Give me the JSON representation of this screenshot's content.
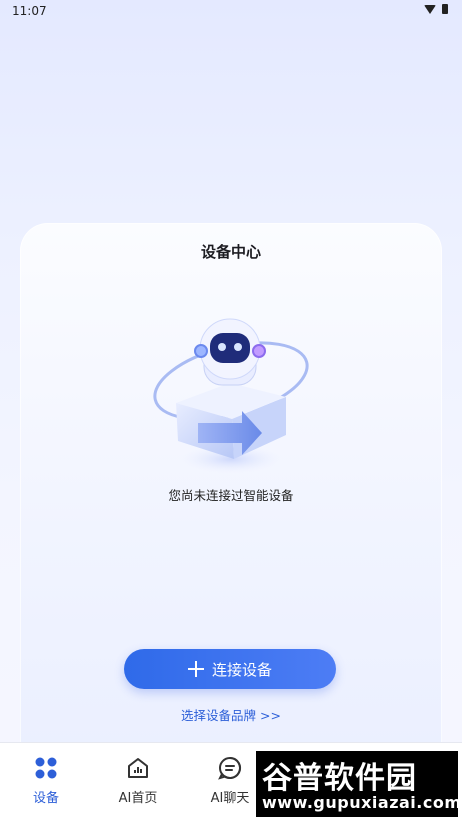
{
  "status_bar": {
    "time": "11:07"
  },
  "card": {
    "title": "设备中心",
    "empty_text": "您尚未连接过智能设备",
    "connect_button": "连接设备",
    "brand_link": "选择设备品牌 >>"
  },
  "tabs": [
    {
      "label": "设备",
      "icon": "devices-grid-icon",
      "active": true
    },
    {
      "label": "AI首页",
      "icon": "ai-home-icon",
      "active": false
    },
    {
      "label": "AI聊天",
      "icon": "chat-icon",
      "active": false
    }
  ],
  "watermark": {
    "title": "谷普软件园",
    "url": "www.gupuxiazai.com"
  },
  "colors": {
    "accent": "#2d5fd8",
    "button_start": "#2f6ae9",
    "button_end": "#4d7df5"
  }
}
